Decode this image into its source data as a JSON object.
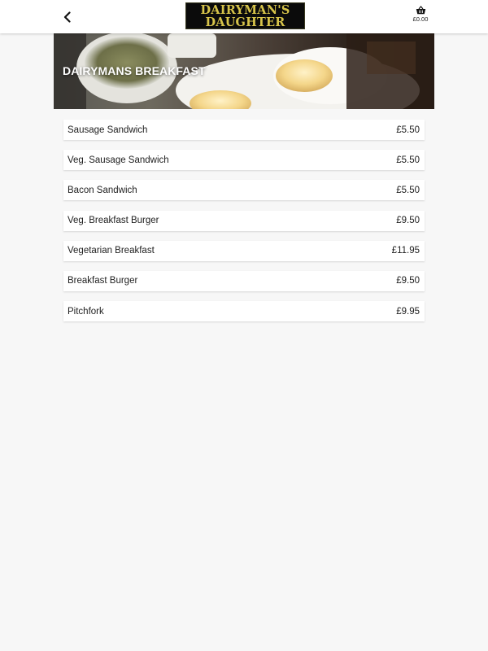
{
  "header": {
    "logo_line1": "DAIRYMAN'S",
    "logo_line2": "DAUGHTER",
    "cart_total": "£0.00",
    "colors": {
      "logo_bg": "#0b0b0b",
      "logo_text": "#d7c44a"
    }
  },
  "icons": {
    "back": "chevron-left-icon",
    "cart": "basket-icon"
  },
  "banner": {
    "title": "DAIRYMANS BREAKFAST"
  },
  "menu": {
    "items": [
      {
        "name": "Sausage Sandwich",
        "price": "£5.50"
      },
      {
        "name": "Veg. Sausage Sandwich",
        "price": "£5.50"
      },
      {
        "name": "Bacon Sandwich",
        "price": "£5.50"
      },
      {
        "name": "Veg. Breakfast Burger",
        "price": "£9.50"
      },
      {
        "name": "Vegetarian Breakfast",
        "price": "£11.95"
      },
      {
        "name": "Breakfast Burger",
        "price": "£9.50"
      },
      {
        "name": "Pitchfork",
        "price": "£9.95"
      }
    ]
  }
}
